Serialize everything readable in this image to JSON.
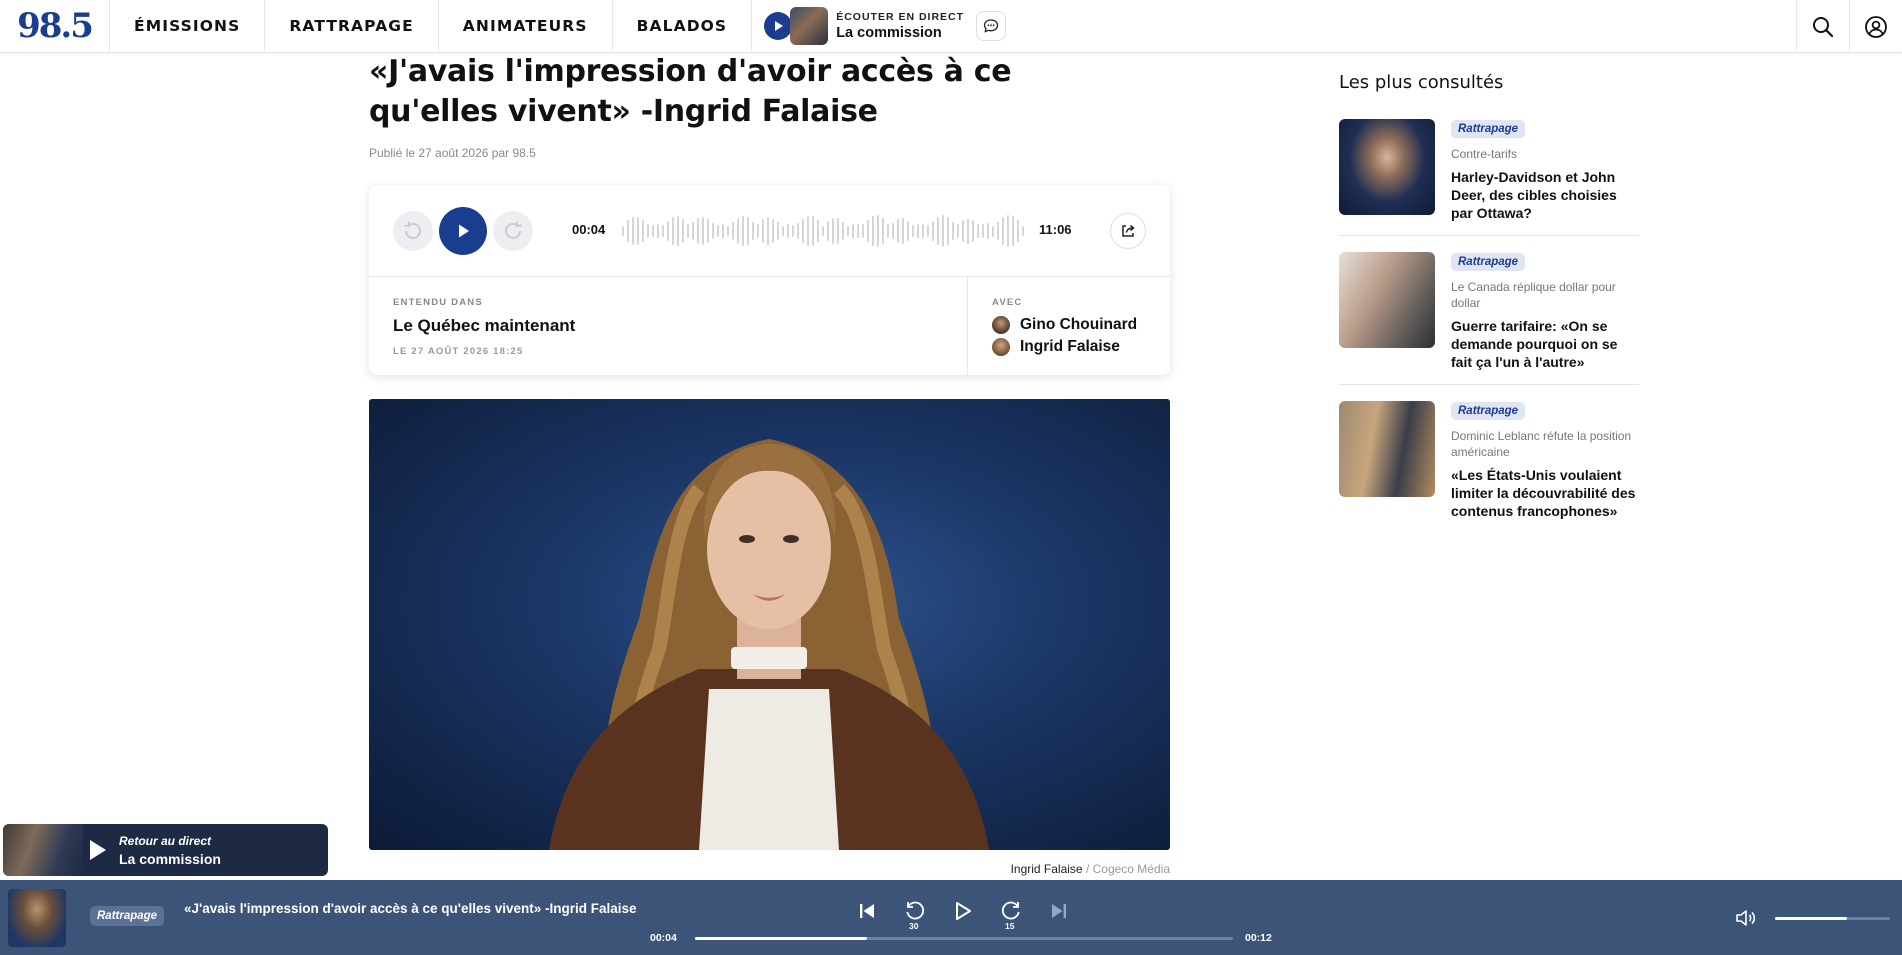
{
  "nav": {
    "logo": "98.5",
    "items": [
      {
        "label": "ÉMISSIONS"
      },
      {
        "label": "RATTRAPAGE"
      },
      {
        "label": "ANIMATEURS"
      },
      {
        "label": "BALADOS"
      }
    ],
    "live_label": "ÉCOUTER EN DIRECT",
    "live_show": "La commission"
  },
  "article": {
    "title": "«J'avais l'impression d'avoir accès à ce qu'elles vivent» -Ingrid Falaise",
    "meta": "Publié le 27 août 2026 par 98.5"
  },
  "audio": {
    "current_time": "00:04",
    "total_time": "11:06",
    "heard_in_label": "ENTENDU DANS",
    "show_name": "Le Québec maintenant",
    "date": "LE 27 AOÛT 2026 18:25",
    "with_label": "AVEC",
    "hosts": [
      {
        "name": "Gino Chouinard"
      },
      {
        "name": "Ingrid Falaise"
      }
    ]
  },
  "hero_caption": {
    "name": "Ingrid Falaise",
    "credit": " / Cogeco Média"
  },
  "sidebar": {
    "title": "Les plus consultés",
    "items": [
      {
        "badge": "Rattrapage",
        "kicker": "Contre-tarifs",
        "headline": "Harley-Davidson et John Deer, des cibles choisies par Ottawa?"
      },
      {
        "badge": "Rattrapage",
        "kicker": "Le Canada réplique dollar pour dollar",
        "headline": "Guerre tarifaire: «On se demande pourquoi on se fait ça l'un à l'autre»"
      },
      {
        "badge": "Rattrapage",
        "kicker": "Dominic Leblanc réfute la position américaine",
        "headline": "«Les États-Unis voulaient limiter la découvrabilité des contenus francophones»"
      }
    ]
  },
  "return_live": {
    "label": "Retour au direct",
    "show": "La commission"
  },
  "player": {
    "badge": "Rattrapage",
    "title": "«J'avais l'impression d'avoir accès à ce qu'elles vivent» -Ingrid Falaise",
    "current_time": "00:04",
    "total_time": "00:12",
    "rewind_seconds": "30",
    "forward_seconds": "15",
    "progress_fraction": 0.32,
    "volume_fraction": 0.63
  },
  "colors": {
    "brand": "#1b3d8f",
    "player_bg": "#3b5478",
    "badge_bg": "#dfe5f3"
  }
}
